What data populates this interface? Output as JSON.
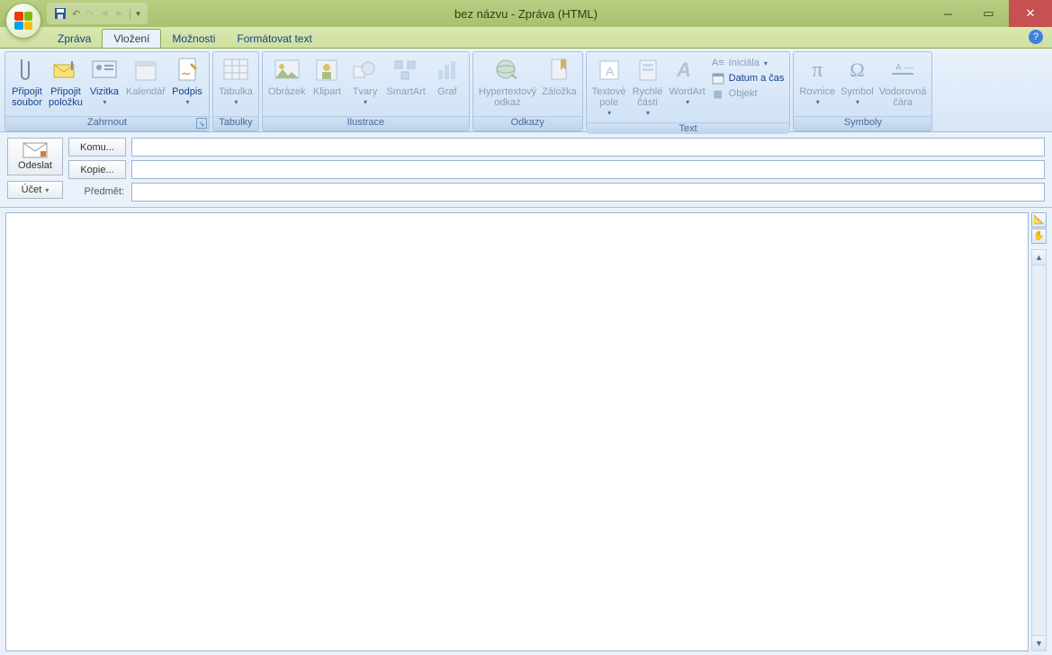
{
  "window": {
    "title": "bez názvu - Zpráva (HTML)"
  },
  "tabs": {
    "message": "Zpráva",
    "insert": "Vložení",
    "options": "Možnosti",
    "format": "Formátovat text"
  },
  "ribbon": {
    "groups": {
      "include": {
        "label": "Zahrnout",
        "attach_file": "Připojit\nsoubor",
        "attach_item": "Připojit\npoložku",
        "business_card": "Vizitka",
        "calendar": "Kalendář",
        "signature": "Podpis"
      },
      "tables": {
        "label": "Tabulky",
        "table": "Tabulka"
      },
      "illustrations": {
        "label": "Ilustrace",
        "picture": "Obrázek",
        "clipart": "Klipart",
        "shapes": "Tvary",
        "smartart": "SmartArt",
        "chart": "Graf"
      },
      "links": {
        "label": "Odkazy",
        "hyperlink": "Hypertextový\nodkaz",
        "bookmark": "Záložka"
      },
      "text": {
        "label": "Text",
        "textbox": "Textové\npole",
        "quickparts": "Rychlé\nčásti",
        "wordart": "WordArt",
        "dropcap": "Iniciála",
        "datetime": "Datum a čas",
        "object": "Objekt"
      },
      "symbols": {
        "label": "Symboly",
        "equation": "Rovnice",
        "symbol": "Symbol",
        "hr": "Vodorovná\nčára"
      }
    }
  },
  "header": {
    "send": "Odeslat",
    "account": "Účet",
    "to": "Komu...",
    "cc": "Kopie...",
    "subject": "Předmět:",
    "to_value": "",
    "cc_value": "",
    "subject_value": ""
  }
}
